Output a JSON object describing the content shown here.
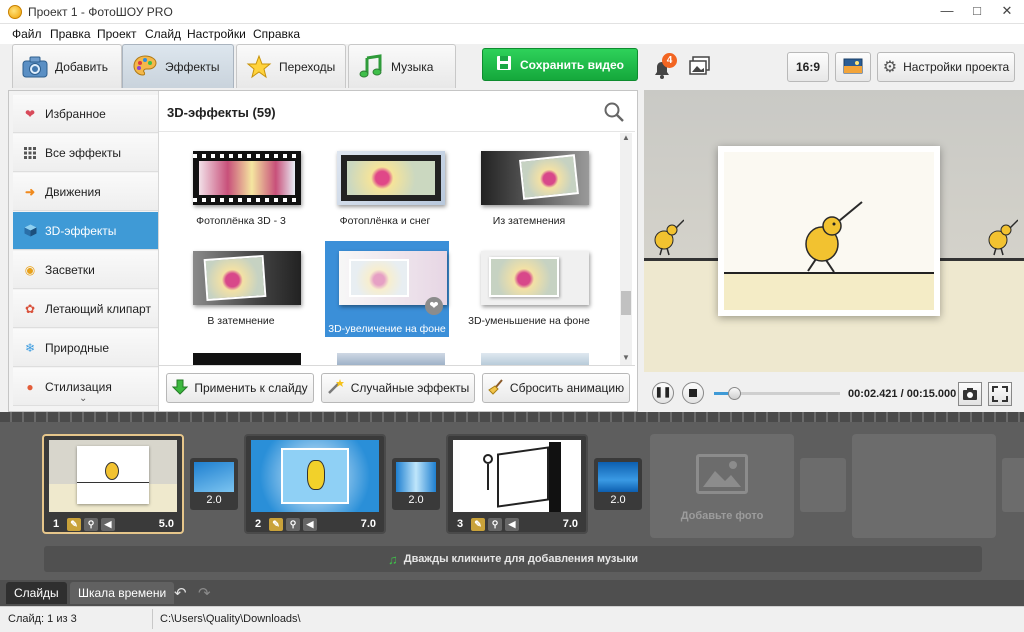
{
  "window": {
    "title": "Проект 1 - ФотоШОУ PRO"
  },
  "menu": [
    "Файл",
    "Правка",
    "Проект",
    "Слайд",
    "Настройки",
    "Справка"
  ],
  "tabs": [
    {
      "label": "Добавить",
      "icon": "camera-icon"
    },
    {
      "label": "Эффекты",
      "icon": "palette-icon"
    },
    {
      "label": "Переходы",
      "icon": "star-icon"
    },
    {
      "label": "Музыка",
      "icon": "music-note-icon"
    }
  ],
  "save_button": {
    "label": "Сохранить видео"
  },
  "sidebar": {
    "items": [
      {
        "label": "Избранное",
        "icon": "heart-icon"
      },
      {
        "label": "Все эффекты",
        "icon": "grid-icon"
      },
      {
        "label": "Движения",
        "icon": "arrow-right-icon"
      },
      {
        "label": "3D-эффекты",
        "icon": "cube-icon"
      },
      {
        "label": "Засветки",
        "icon": "sun-icon"
      },
      {
        "label": "Летающий клипарт",
        "icon": "clipart-icon"
      },
      {
        "label": "Природные",
        "icon": "snowflake-icon"
      },
      {
        "label": "Стилизация",
        "icon": "circle-icon"
      }
    ]
  },
  "gallery": {
    "heading": "3D-эффекты (59)",
    "thumbnails": [
      {
        "label": "Фотоплёнка 3D - 3"
      },
      {
        "label": "Фотоплёнка и снег"
      },
      {
        "label": "Из затемнения"
      },
      {
        "label": "В затемнение"
      },
      {
        "label": "3D-увеличение на фоне"
      },
      {
        "label": "3D-уменьшение на фоне"
      }
    ]
  },
  "actions": {
    "apply": "Применить к слайду",
    "random": "Случайные эффекты",
    "reset": "Сбросить анимацию"
  },
  "right_toolbar": {
    "notifications_count": "4",
    "aspect_ratio": "16:9",
    "settings": "Настройки проекта"
  },
  "player": {
    "time": "00:02.421 / 00:15.000",
    "progress": 0.16
  },
  "timeline": {
    "slides": [
      {
        "number": "1",
        "duration": "5.0"
      },
      {
        "number": "2",
        "duration": "7.0"
      },
      {
        "number": "3",
        "duration": "7.0"
      }
    ],
    "transitions": [
      "2.0",
      "2.0",
      "2.0"
    ],
    "add_photo": "Добавьте фото",
    "music_hint": "Дважды кликните для добавления музыки"
  },
  "bottom_tabs": [
    "Слайды",
    "Шкала времени"
  ],
  "status": {
    "slide": "Слайд: 1 из 3",
    "path": "C:\\Users\\Quality\\Downloads\\"
  },
  "colors": {
    "accent": "#3f9ad6",
    "save_green": "#1fbf4b",
    "selected_slide_border": "#e6c68b",
    "notification_badge": "#f26522"
  }
}
